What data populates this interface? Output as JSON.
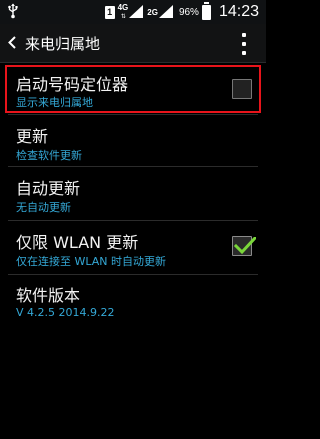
{
  "status_bar": {
    "sim1_label": "1",
    "net1_gen": "4G",
    "net2_gen": "2G",
    "net_arrows": "⇅",
    "battery_percent": "96%",
    "battery_level": 0.96,
    "time": "14:23"
  },
  "action_bar": {
    "title": "来电归属地"
  },
  "settings": [
    {
      "title": "启动号码定位器",
      "subtitle": "显示来电归属地",
      "checkbox": "unchecked"
    },
    {
      "title": "更新",
      "subtitle": "检查软件更新"
    },
    {
      "title": "自动更新",
      "subtitle": "无自动更新"
    },
    {
      "title": "仅限 WLAN 更新",
      "subtitle": "仅在连接至 WLAN 时自动更新",
      "checkbox": "checked"
    },
    {
      "title": "软件版本",
      "subtitle": "V 4.2.5 2014.9.22"
    }
  ],
  "colors": {
    "accent": "#34a8d6",
    "highlight_border": "#e8141b",
    "check_green": "#7ad63a",
    "background": "#000000"
  }
}
